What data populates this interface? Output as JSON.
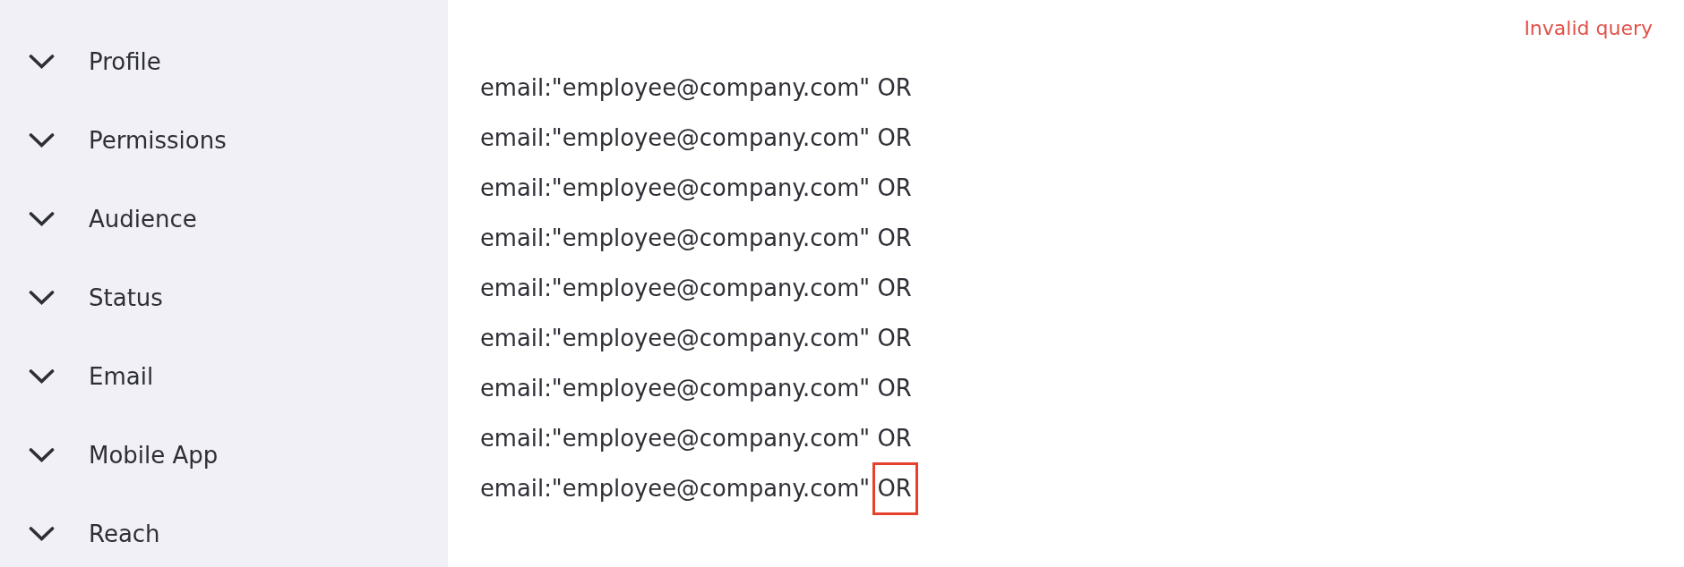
{
  "sidebar": {
    "sections": [
      {
        "label": "Profile",
        "expanded": false
      },
      {
        "label": "Permissions",
        "expanded": false
      },
      {
        "label": "Audience",
        "expanded": false
      },
      {
        "label": "Status",
        "expanded": false
      },
      {
        "label": "Email",
        "expanded": false
      },
      {
        "label": "Mobile App",
        "expanded": false
      },
      {
        "label": "Reach",
        "expanded": false
      }
    ]
  },
  "query_panel": {
    "error": "Invalid query",
    "lines": [
      {
        "term": "email:\"employee@company.com\"",
        "operator": "OR",
        "highlighted": false
      },
      {
        "term": "email:\"employee@company.com\"",
        "operator": "OR",
        "highlighted": false
      },
      {
        "term": "email:\"employee@company.com\"",
        "operator": "OR",
        "highlighted": false
      },
      {
        "term": "email:\"employee@company.com\"",
        "operator": "OR",
        "highlighted": false
      },
      {
        "term": "email:\"employee@company.com\"",
        "operator": "OR",
        "highlighted": false
      },
      {
        "term": "email:\"employee@company.com\"",
        "operator": "OR",
        "highlighted": false
      },
      {
        "term": "email:\"employee@company.com\"",
        "operator": "OR",
        "highlighted": false
      },
      {
        "term": "email:\"employee@company.com\"",
        "operator": "OR",
        "highlighted": false
      },
      {
        "term": "email:\"employee@company.com\"",
        "operator": "OR",
        "highlighted": true
      }
    ]
  }
}
